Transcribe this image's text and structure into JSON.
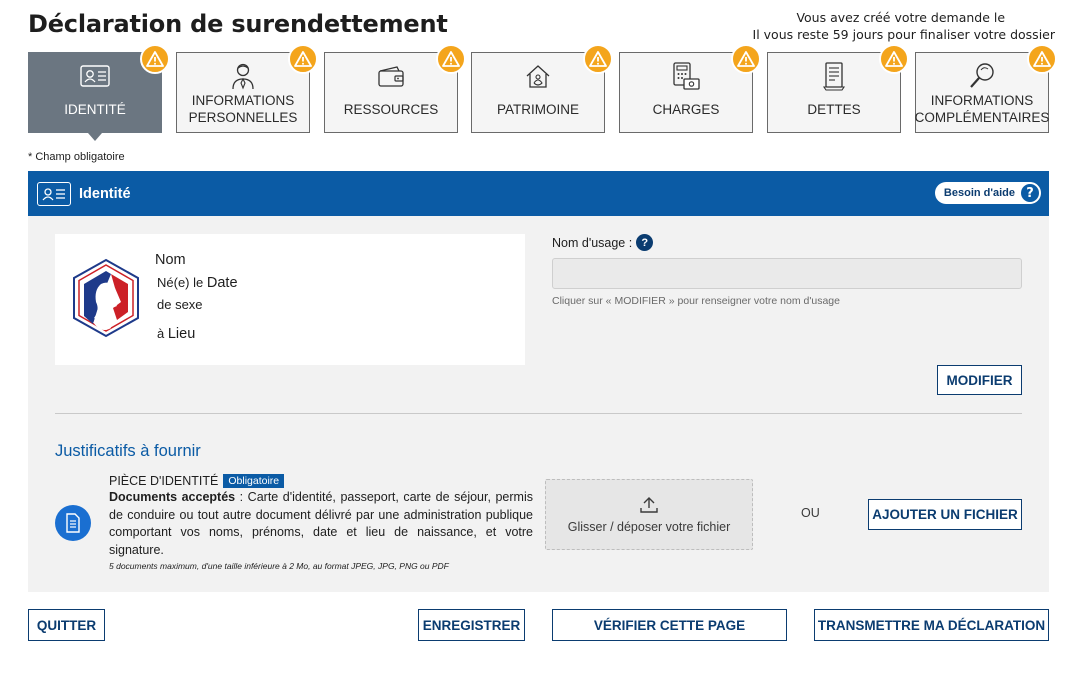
{
  "page": {
    "title": "Déclaration de surendettement",
    "deadline_line1": "Vous avez créé votre demande le",
    "deadline_line2": "Il vous reste 59 jours pour finaliser votre dossier"
  },
  "tabs": [
    {
      "label_line1": "IDENTITÉ",
      "label_line2": "",
      "icon": "id-card-icon",
      "active": true
    },
    {
      "label_line1": "INFORMATIONS",
      "label_line2": "PERSONNELLES",
      "icon": "person-icon",
      "active": false
    },
    {
      "label_line1": "RESSOURCES",
      "label_line2": "",
      "icon": "wallet-icon",
      "active": false
    },
    {
      "label_line1": "PATRIMOINE",
      "label_line2": "",
      "icon": "house-icon",
      "active": false
    },
    {
      "label_line1": "CHARGES",
      "label_line2": "",
      "icon": "calculator-icon",
      "active": false
    },
    {
      "label_line1": "DETTES",
      "label_line2": "",
      "icon": "bill-icon",
      "active": false
    },
    {
      "label_line1": "INFORMATIONS",
      "label_line2": "COMPLÉMENTAIRES",
      "icon": "magnifier-icon",
      "active": false
    }
  ],
  "required_note": "* Champ obligatoire",
  "section": {
    "title": "Identité",
    "help_label": "Besoin d'aide",
    "help_symbol": "?"
  },
  "identity": {
    "name": "Nom",
    "born_prefix": "Né(e) le",
    "date": "Date",
    "sex": "de sexe",
    "place_prefix": "à",
    "place": "Lieu"
  },
  "usage": {
    "label": "Nom d'usage :",
    "help_symbol": "?",
    "value": "",
    "hint": "Cliquer sur « MODIFIER » pour renseigner votre nom d'usage",
    "modify_label": "MODIFIER"
  },
  "justificatifs": {
    "title": "Justificatifs à fournir",
    "piece_title": "PIÈCE D'IDENTITÉ",
    "badge": "Obligatoire",
    "accepted_label": "Documents acceptés",
    "accepted_text": " : Carte d'identité, passeport, carte de séjour, permis de conduire ou tout autre document délivré par une administration publique comportant vos noms, prénoms, date et lieu de naissance, et votre signature.",
    "limits": "5 documents maximum, d'une taille inférieure à 2 Mo, au format JPEG, JPG, PNG ou PDF",
    "dropzone_label": "Glisser / déposer votre fichier",
    "or_label": "OU",
    "add_file_label": "AJOUTER UN FICHIER"
  },
  "footer": {
    "quit_label": "QUITTER",
    "save_label": "ENREGISTRER",
    "verify_label": "VÉRIFIER CETTE PAGE",
    "submit_label": "TRANSMETTRE MA DÉCLARATION"
  },
  "colors": {
    "header_blue": "#0b5ba5",
    "dark_blue": "#0b3c70",
    "active_tab": "#6b7681",
    "warning": "#f4a51c",
    "panel_bg": "#f2f2f2"
  }
}
